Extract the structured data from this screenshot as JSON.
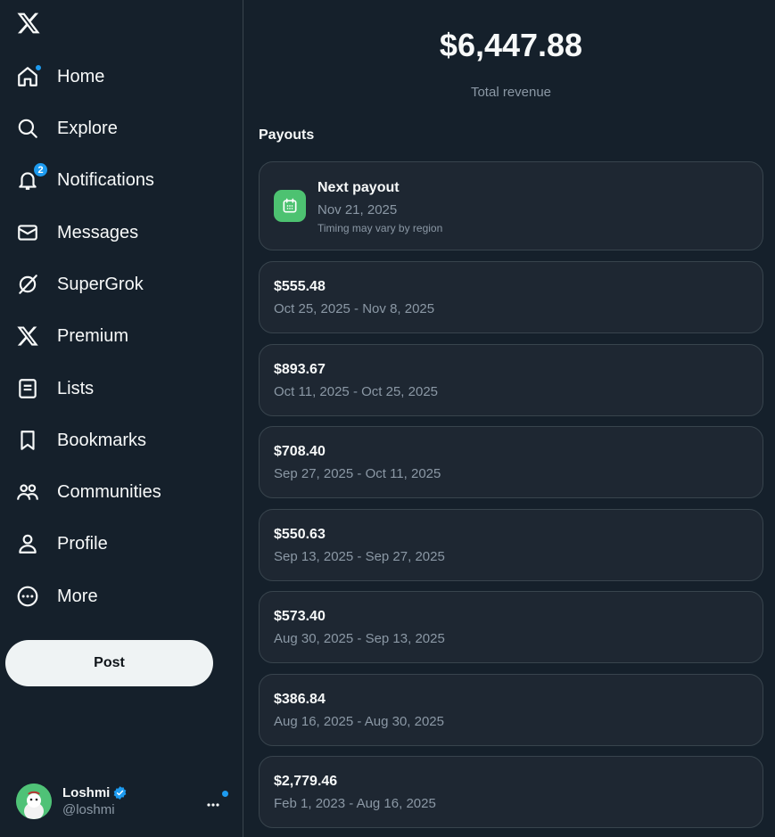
{
  "sidebar": {
    "items": [
      {
        "label": "Home",
        "icon": "home-icon"
      },
      {
        "label": "Explore",
        "icon": "search-icon"
      },
      {
        "label": "Notifications",
        "icon": "bell-icon",
        "badge": "2"
      },
      {
        "label": "Messages",
        "icon": "envelope-icon"
      },
      {
        "label": "SuperGrok",
        "icon": "grok-icon"
      },
      {
        "label": "Premium",
        "icon": "x-logo-icon"
      },
      {
        "label": "Lists",
        "icon": "list-icon"
      },
      {
        "label": "Bookmarks",
        "icon": "bookmark-icon"
      },
      {
        "label": "Communities",
        "icon": "communities-icon"
      },
      {
        "label": "Profile",
        "icon": "person-icon"
      },
      {
        "label": "More",
        "icon": "more-circle-icon"
      }
    ],
    "post_label": "Post",
    "account": {
      "name": "Loshmi",
      "handle": "@loshmi"
    }
  },
  "main": {
    "total_revenue": "$6,447.88",
    "total_label": "Total revenue",
    "section_title": "Payouts",
    "next_payout": {
      "title": "Next payout",
      "date": "Nov 21, 2025",
      "note": "Timing may vary by region"
    },
    "payouts": [
      {
        "amount": "$555.48",
        "range": "Oct 25, 2025 - Nov 8, 2025"
      },
      {
        "amount": "$893.67",
        "range": "Oct 11, 2025 - Oct 25, 2025"
      },
      {
        "amount": "$708.40",
        "range": "Sep 27, 2025 - Oct 11, 2025"
      },
      {
        "amount": "$550.63",
        "range": "Sep 13, 2025 - Sep 27, 2025"
      },
      {
        "amount": "$573.40",
        "range": "Aug 30, 2025 - Sep 13, 2025"
      },
      {
        "amount": "$386.84",
        "range": "Aug 16, 2025 - Aug 30, 2025"
      },
      {
        "amount": "$2,779.46",
        "range": "Feb 1, 2023 - Aug 16, 2025"
      }
    ]
  },
  "colors": {
    "background": "#15202b",
    "card": "#1e2732",
    "border": "#38444d",
    "accent": "#1d9bf0",
    "calendar_green": "#4dc271",
    "muted_text": "#8b98a5"
  }
}
